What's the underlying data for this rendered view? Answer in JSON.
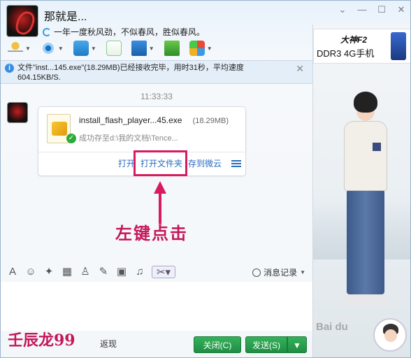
{
  "header": {
    "contact_name": "那就是...",
    "signature": "一年一度秋风劲，不似春风，胜似春风。"
  },
  "notice": {
    "text": "文件\"inst...145.exe\"(18.29MB)已经接收完毕，用时31秒，平均速度604.15KB/S.",
    "close": "✕"
  },
  "chat": {
    "timestamp": "11:33:33",
    "file": {
      "name": "install_flash_player...45.exe",
      "size": "(18.29MB)",
      "status": "成功存至d:\\我的文档\\Tence...",
      "actions": {
        "open": "打开",
        "open_folder": "打开文件夹",
        "save_cloud": "存到微云"
      }
    },
    "annotation": "左键点击"
  },
  "input_toolbar": {
    "history_label": "消息记录"
  },
  "bottom": {
    "watermark": "壬辰龙99",
    "tail_text": "返现",
    "close_label": "关闭(C)",
    "send_label": "发送(S)"
  },
  "side": {
    "ad_brand": "大神F2",
    "ad_text": "DDR3 4G手机",
    "baidu_mark": "Bai du"
  },
  "colors": {
    "accent_green": "#2aa14f",
    "annotation_pink": "#d81b60",
    "link_blue": "#2a6cc0"
  }
}
